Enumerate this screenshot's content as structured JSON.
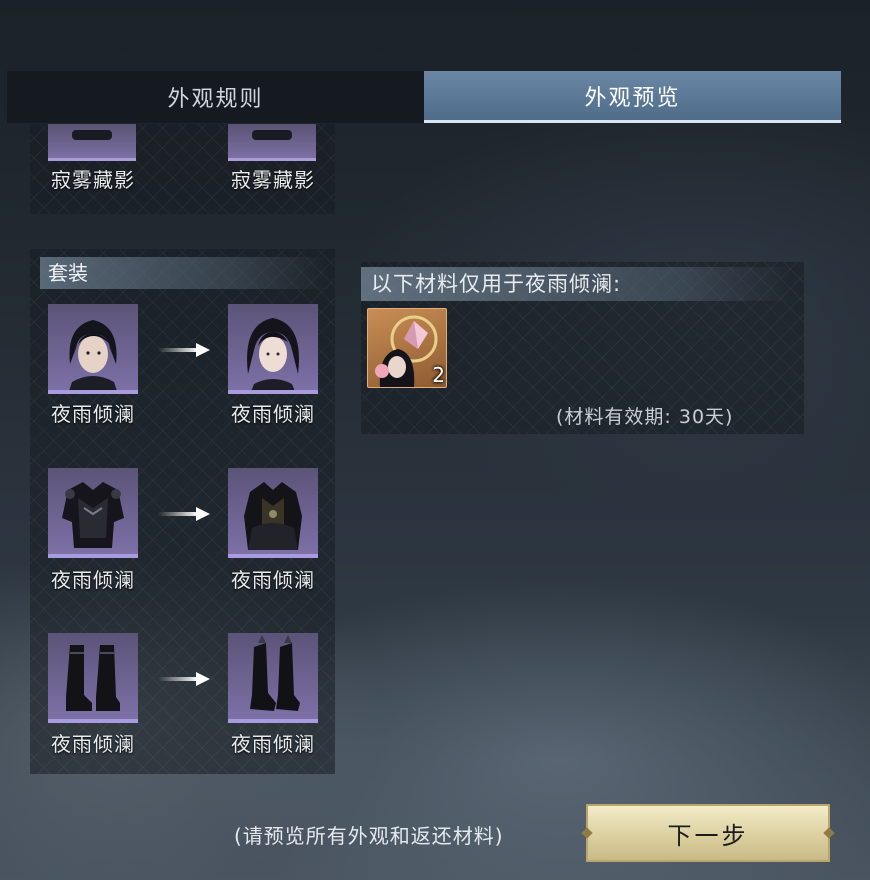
{
  "tabs": [
    {
      "label": "外观规则",
      "active": false
    },
    {
      "label": "外观预览",
      "active": true
    }
  ],
  "top_items": {
    "left_label": "寂雾藏影",
    "right_label": "寂雾藏影"
  },
  "set_section": {
    "title": "套装",
    "rows": [
      {
        "from_label": "夜雨倾澜",
        "to_label": "夜雨倾澜",
        "from_icon": "hair-female-icon",
        "to_icon": "hair-female-icon"
      },
      {
        "from_label": "夜雨倾澜",
        "to_label": "夜雨倾澜",
        "from_icon": "armor-outfit-icon",
        "to_icon": "armor-outfit-icon"
      },
      {
        "from_label": "夜雨倾澜",
        "to_label": "夜雨倾澜",
        "from_icon": "boots-icon",
        "to_icon": "boots-icon"
      }
    ]
  },
  "materials": {
    "header": "以下材料仅用于夜雨倾澜:",
    "item_icon": "hairstyle-token-icon",
    "count": "2",
    "validity": "(材料有效期: 30天)"
  },
  "footer": {
    "hint": "(请预览所有外观和返还材料)",
    "next_button": "下一步"
  },
  "colors": {
    "active_tab": "#5b7a98",
    "thumb_bg": "#6b6290",
    "thumb_border": "#a99cde",
    "button_bg": "#e6dcb0",
    "material_bg": "#b07a45"
  }
}
